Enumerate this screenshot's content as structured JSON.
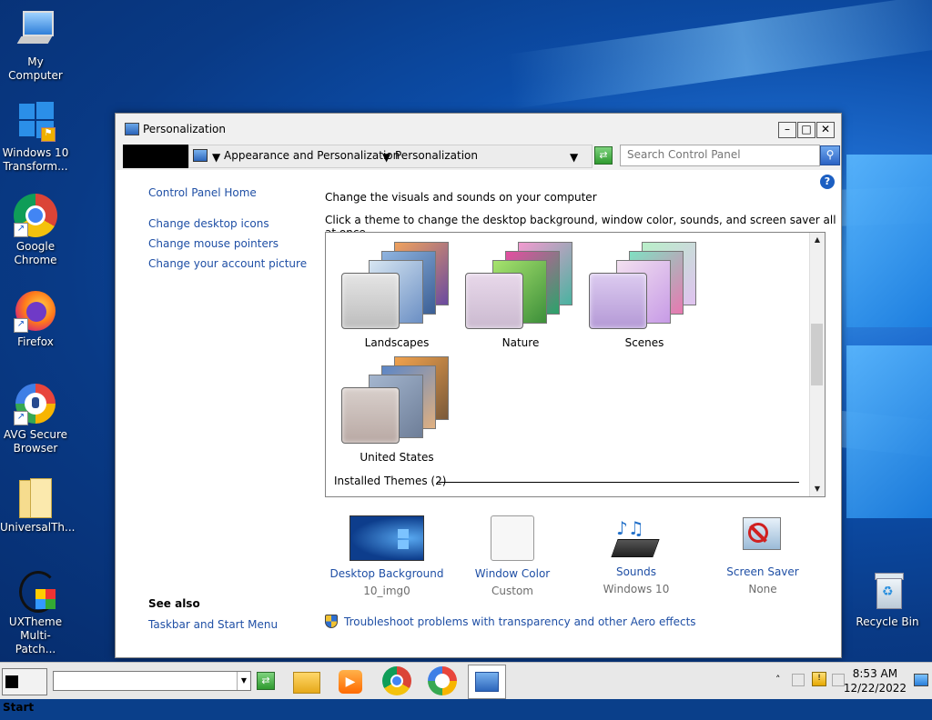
{
  "desktop": {
    "icons": [
      {
        "label": "My Computer",
        "icon": "computer-icon"
      },
      {
        "label": "Windows 10 Transform...",
        "icon": "windows-logo-icon"
      },
      {
        "label": "Google Chrome",
        "icon": "chrome-icon"
      },
      {
        "label": "Firefox",
        "icon": "firefox-icon"
      },
      {
        "label": "AVG Secure Browser",
        "icon": "avg-browser-icon"
      },
      {
        "label": "UniversalTh...",
        "icon": "folder-icon"
      },
      {
        "label": "UXTheme Multi-Patch...",
        "icon": "uxtheme-icon"
      },
      {
        "label": "Recycle Bin",
        "icon": "recycle-bin-icon"
      }
    ]
  },
  "window": {
    "title": "Personalization",
    "controls": {
      "minimize": "–",
      "maximize": "□",
      "close": "✕"
    },
    "address": {
      "crumb1": "Appearance and Personalization",
      "crumb2": "Personalization"
    },
    "search": {
      "placeholder": "Search Control Panel",
      "value": ""
    },
    "sidebar": {
      "home": "Control Panel Home",
      "links": [
        "Change desktop icons",
        "Change mouse pointers",
        "Change your account picture"
      ],
      "see_also_label": "See also",
      "see_also_links": [
        "Taskbar and Start Menu"
      ]
    },
    "main": {
      "title": "Change the visuals and sounds on your computer",
      "subtitle": "Click a theme to change the desktop background, window color, sounds, and screen saver all at once.",
      "themes": [
        {
          "name": "Landscapes",
          "colors": [
            "#6b8fc4",
            "#e7a46b",
            "#3d5a8c"
          ]
        },
        {
          "name": "Nature",
          "colors": [
            "#7fd36a",
            "#e64da2",
            "#49b3a0"
          ]
        },
        {
          "name": "Scenes",
          "colors": [
            "#c79be6",
            "#8ce0b5",
            "#f0c7e0"
          ]
        },
        {
          "name": "United States",
          "colors": [
            "#f1a24d",
            "#5a86c8",
            "#a4b6cf"
          ]
        }
      ],
      "installed_section": "Installed Themes (2)",
      "bottom": [
        {
          "name": "Desktop Background",
          "value": "10_img0",
          "icon": "desktop-background-icon"
        },
        {
          "name": "Window Color",
          "value": "Custom",
          "icon": "window-color-icon"
        },
        {
          "name": "Sounds",
          "value": "Windows 10",
          "icon": "sounds-icon"
        },
        {
          "name": "Screen Saver",
          "value": "None",
          "icon": "screen-saver-icon"
        }
      ],
      "troubleshoot": "Troubleshoot problems with transparency and other Aero effects"
    }
  },
  "taskbar": {
    "start": "Start",
    "time": "8:53 AM",
    "date": "12/22/2022",
    "apps": [
      "file-explorer-icon",
      "media-player-icon",
      "chrome-icon",
      "avg-browser-icon",
      "control-panel-icon"
    ]
  }
}
